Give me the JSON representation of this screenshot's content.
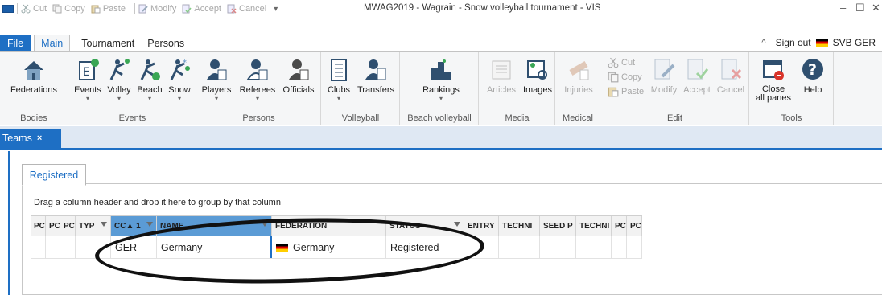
{
  "titlebar": {
    "quick_access": [
      {
        "label": "Cut",
        "icon": "cut-icon"
      },
      {
        "label": "Copy",
        "icon": "copy-icon"
      },
      {
        "label": "Paste",
        "icon": "paste-icon"
      },
      {
        "label": "Modify",
        "icon": "modify-icon"
      },
      {
        "label": "Accept",
        "icon": "accept-icon"
      },
      {
        "label": "Cancel",
        "icon": "cancel-icon"
      }
    ],
    "title": "MWAG2019 - Wagrain - Snow volleyball tournament - VIS"
  },
  "ribbon_tabs": {
    "file": "File",
    "main": "Main",
    "tournament": "Tournament",
    "persons": "Persons",
    "sign_out": "Sign out",
    "user": "SVB GER"
  },
  "ribbon": {
    "bodies": {
      "label": "Bodies",
      "federations": "Federations"
    },
    "events": {
      "label": "Events",
      "events": "Events",
      "volley": "Volley",
      "beach": "Beach",
      "snow": "Snow"
    },
    "persons": {
      "label": "Persons",
      "players": "Players",
      "referees": "Referees",
      "officials": "Officials"
    },
    "volleyball": {
      "label": "Volleyball",
      "clubs": "Clubs",
      "transfers": "Transfers"
    },
    "beach": {
      "label": "Beach volleyball",
      "rankings": "Rankings"
    },
    "media": {
      "label": "Media",
      "articles": "Articles",
      "images": "Images"
    },
    "medical": {
      "label": "Medical",
      "injuries": "Injuries"
    },
    "edit": {
      "label": "Edit",
      "cut": "Cut",
      "copy": "Copy",
      "paste": "Paste",
      "modify": "Modify",
      "accept": "Accept",
      "cancel": "Cancel"
    },
    "tools": {
      "label": "Tools",
      "close_all_1": "Close",
      "close_all_2": "all panes",
      "help": "Help"
    }
  },
  "doc_tab": {
    "label": "Teams",
    "close": "×"
  },
  "subtab": {
    "label": "Registered"
  },
  "hint": "Drag a column header and drop it here to group by that column",
  "colors": {
    "accent": "#1e6fc4",
    "selected_header": "#5b9bd5"
  },
  "grid": {
    "headers": [
      "PC",
      "PC",
      "PC",
      "TYP",
      "CC▲ 1",
      "NAME",
      "FEDERATION",
      "STATUS",
      "ENTRY",
      "TECHNI",
      "SEED P",
      "TECHNI",
      "PC",
      "PC"
    ],
    "row": [
      "",
      "",
      "",
      "",
      "GER",
      "Germany",
      "Germany",
      "Registered",
      "",
      "",
      "",
      "",
      "",
      ""
    ]
  }
}
